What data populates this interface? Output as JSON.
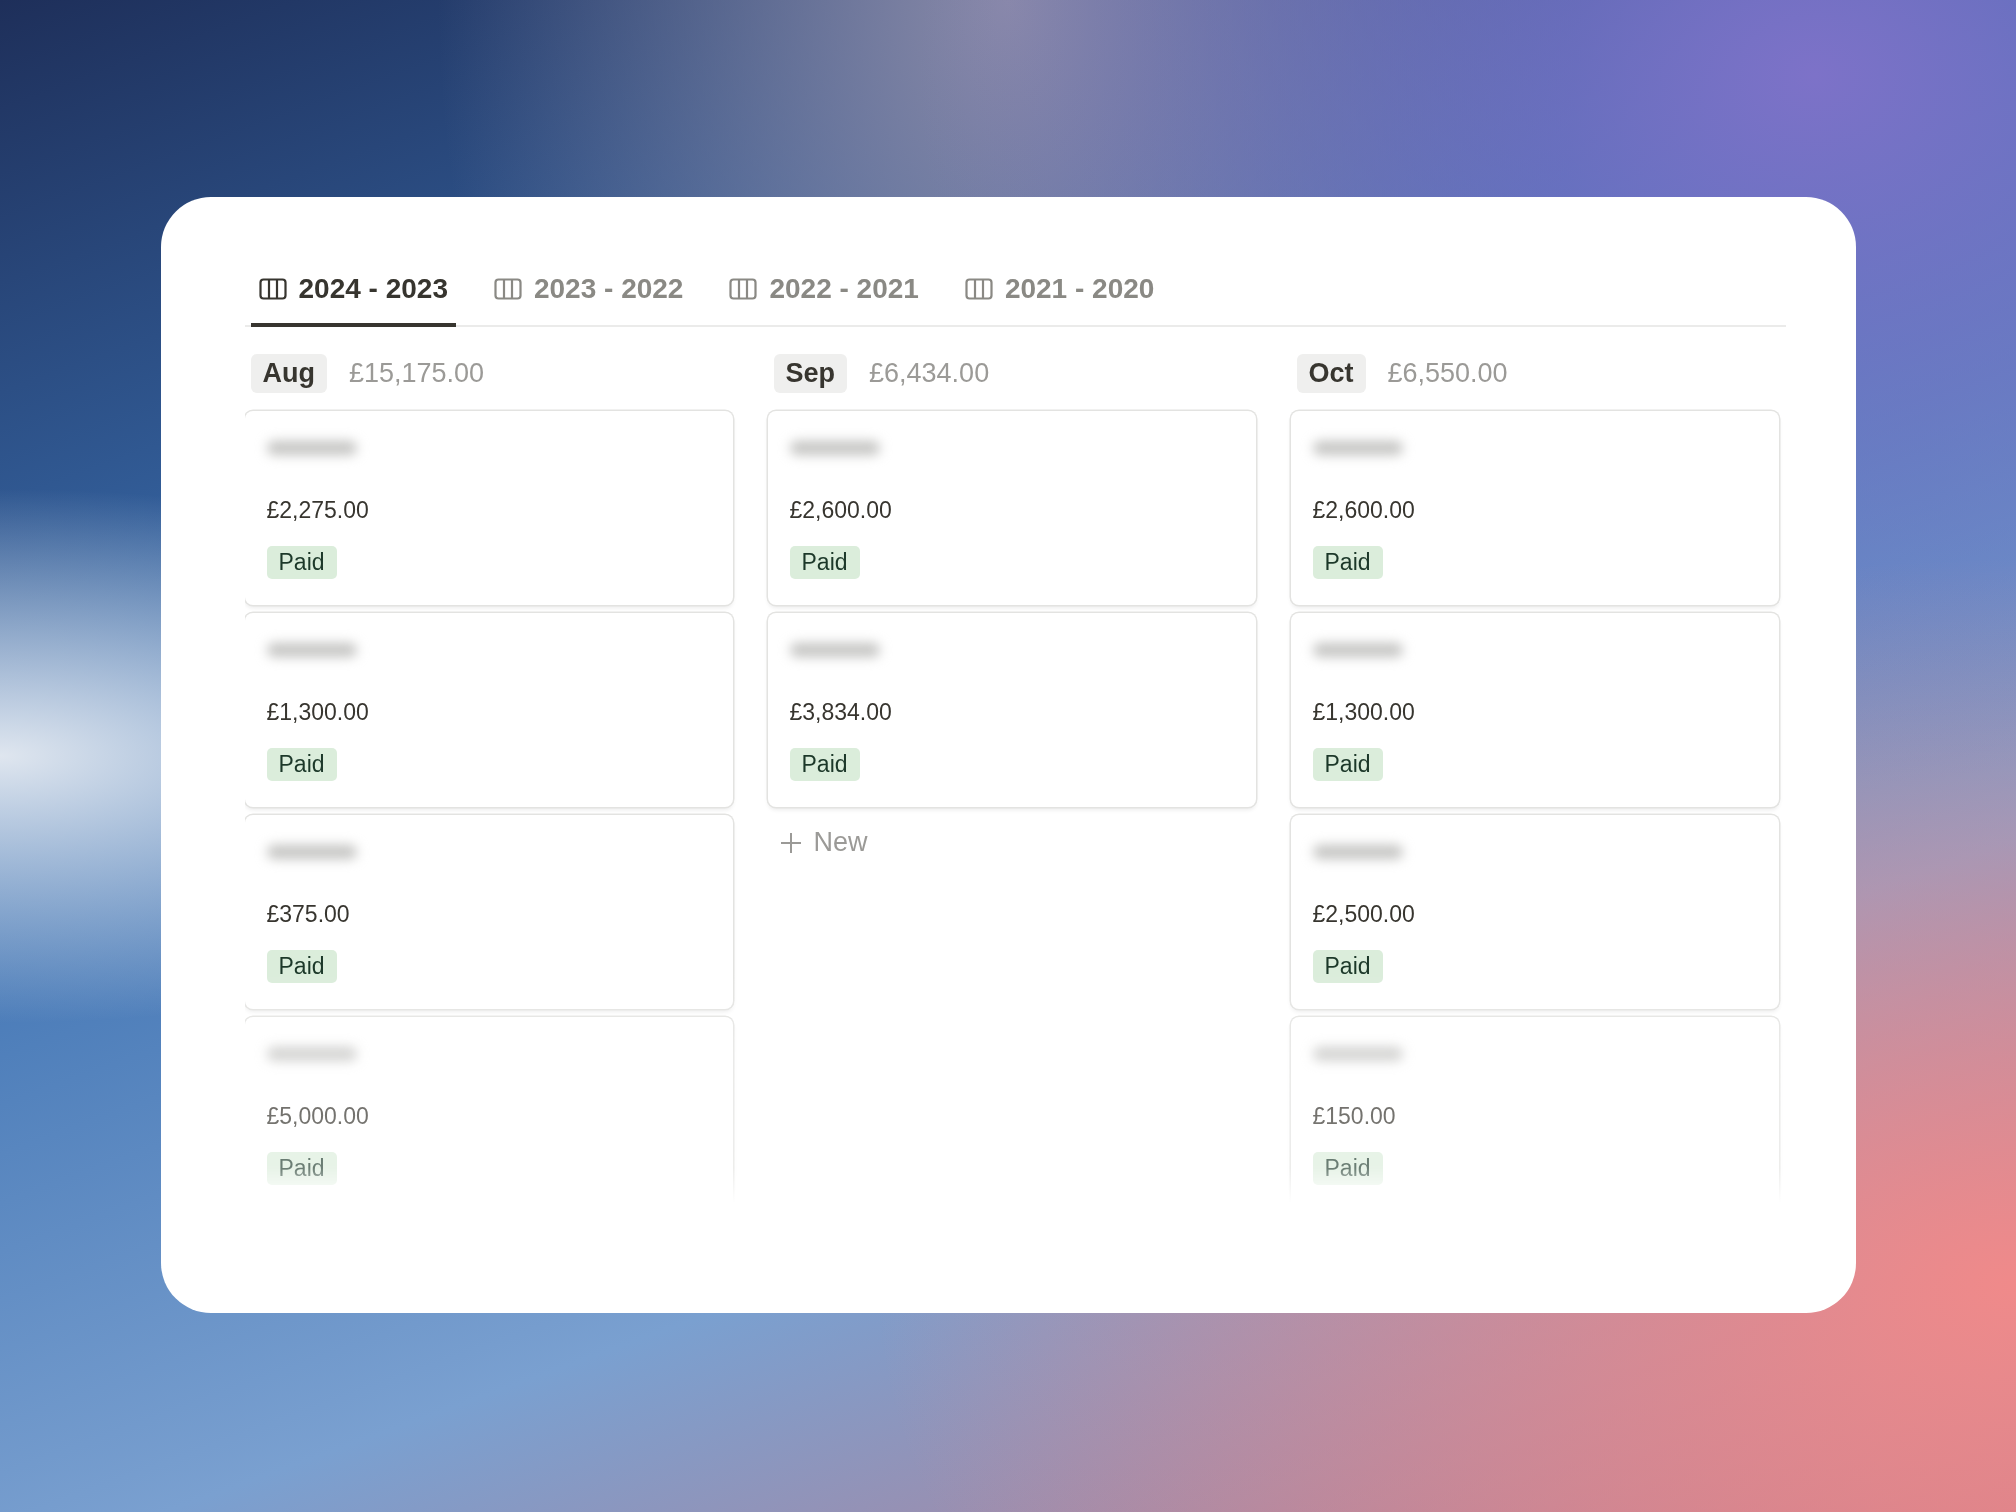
{
  "tabs": [
    {
      "label": "2024 - 2023",
      "selected": true
    },
    {
      "label": "2023 - 2022",
      "selected": false
    },
    {
      "label": "2022 - 2021",
      "selected": false
    },
    {
      "label": "2021 - 2020",
      "selected": false
    }
  ],
  "columns": [
    {
      "month": "Aug",
      "total": "£15,175.00",
      "cards": [
        {
          "amount": "£2,275.00",
          "status": "Paid"
        },
        {
          "amount": "£1,300.00",
          "status": "Paid"
        },
        {
          "amount": "£375.00",
          "status": "Paid"
        },
        {
          "amount": "£5,000.00",
          "status": "Paid"
        }
      ]
    },
    {
      "month": "Sep",
      "total": "£6,434.00",
      "cards": [
        {
          "amount": "£2,600.00",
          "status": "Paid"
        },
        {
          "amount": "£3,834.00",
          "status": "Paid"
        }
      ],
      "new_label": "New"
    },
    {
      "month": "Oct",
      "total": "£6,550.00",
      "cards": [
        {
          "amount": "£2,600.00",
          "status": "Paid"
        },
        {
          "amount": "£1,300.00",
          "status": "Paid"
        },
        {
          "amount": "£2,500.00",
          "status": "Paid"
        },
        {
          "amount": "£150.00",
          "status": "Paid"
        }
      ]
    }
  ]
}
